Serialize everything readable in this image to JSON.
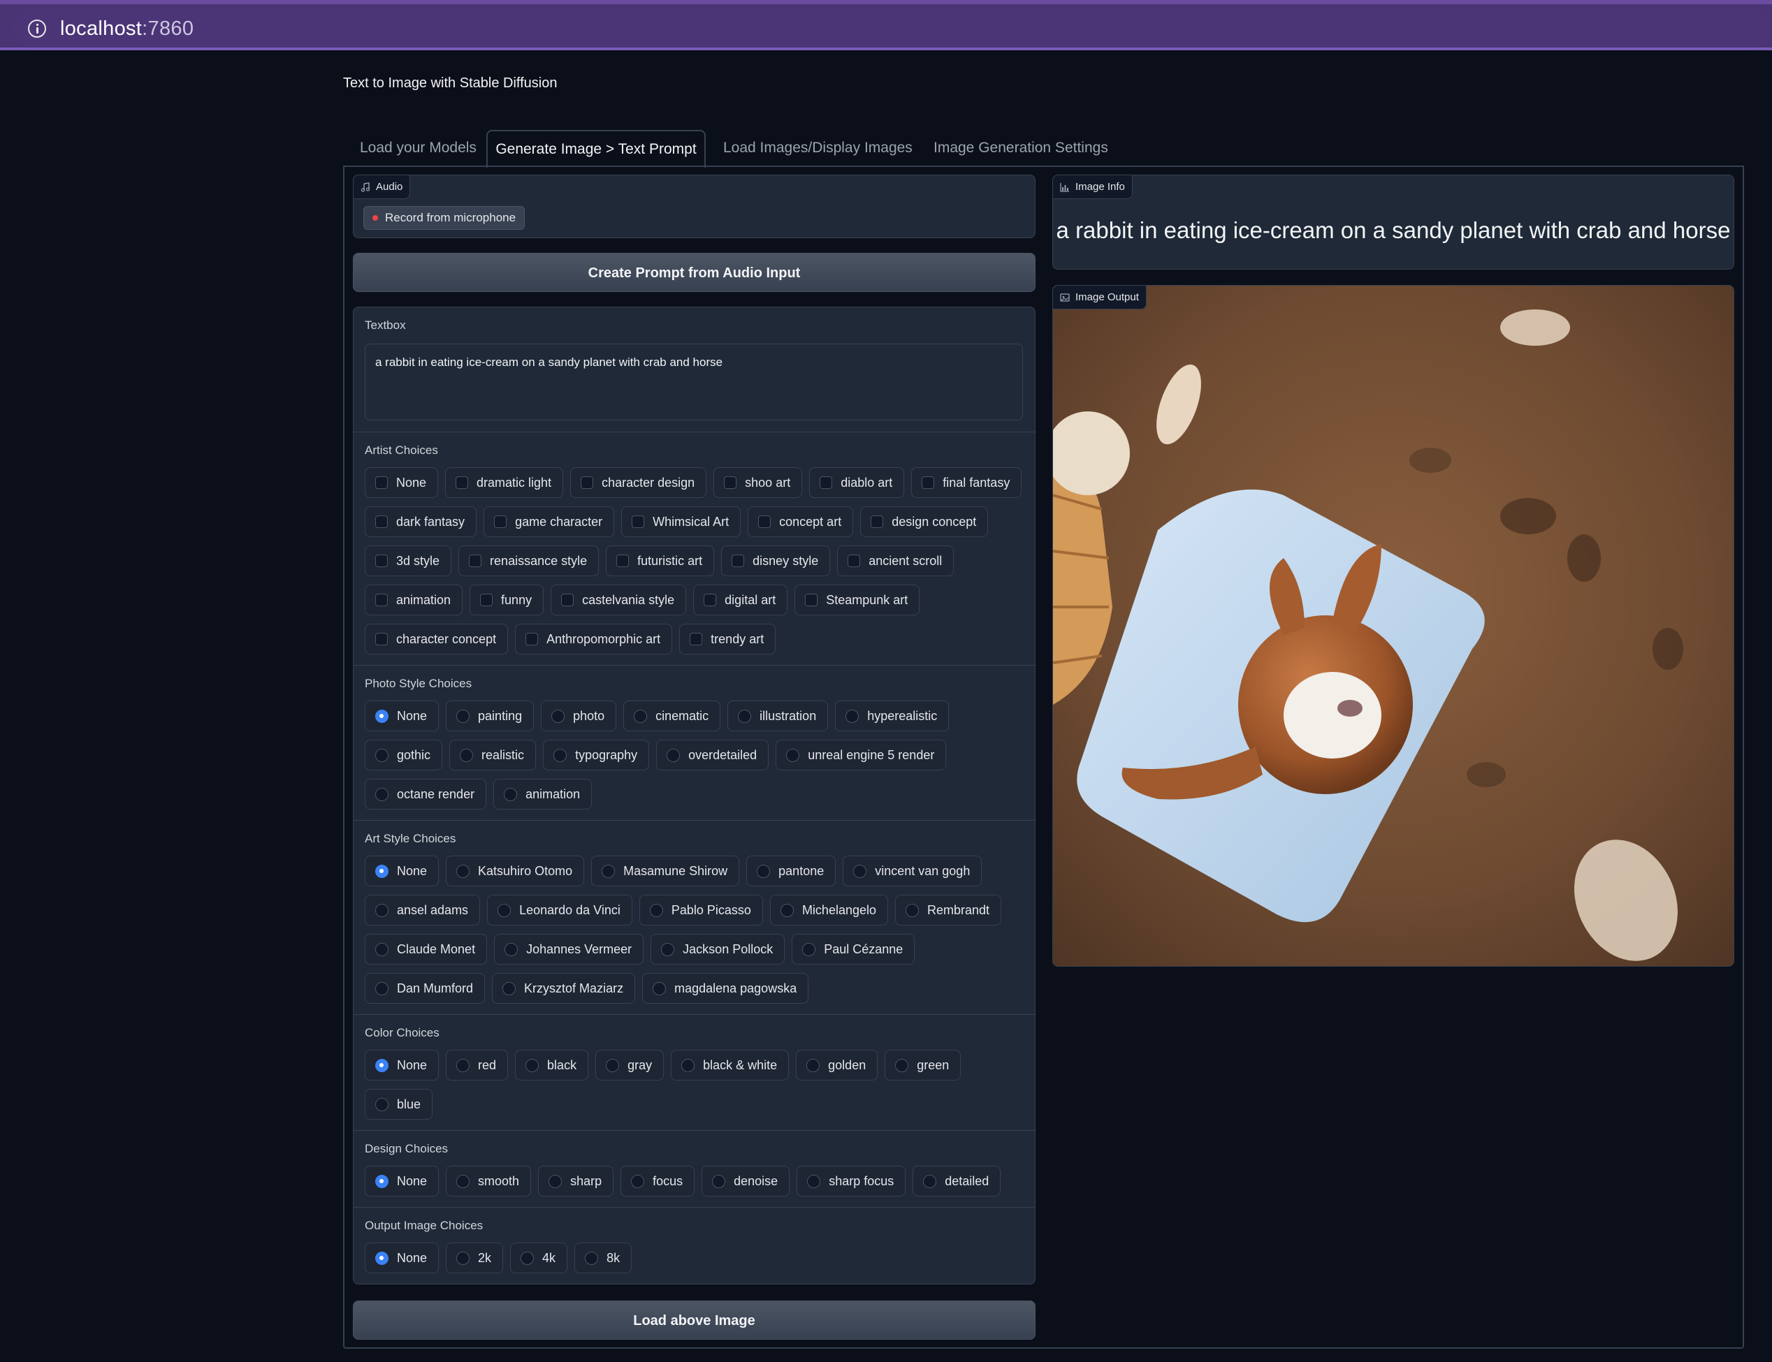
{
  "browser": {
    "url_host": "localhost",
    "url_port": ":7860"
  },
  "app": {
    "title": "Text to Image with Stable Diffusion"
  },
  "tabs": [
    {
      "label": "Load your Models"
    },
    {
      "label": "Generate Image > Text Prompt"
    },
    {
      "label": "Load Images/Display Images"
    },
    {
      "label": "Image Generation Settings"
    }
  ],
  "audio": {
    "label": "Audio",
    "record_label": "Record from microphone"
  },
  "create_prompt_button": "Create Prompt from Audio Input",
  "textbox": {
    "label": "Textbox",
    "value": "a rabbit in eating ice-cream on a sandy planet with crab and horse"
  },
  "artist": {
    "label": "Artist Choices",
    "options": [
      "None",
      "dramatic light",
      "character design",
      "shoo art",
      "diablo art",
      "final fantasy",
      "dark fantasy",
      "game character",
      "Whimsical Art",
      "concept art",
      "design concept",
      "3d style",
      "renaissance style",
      "futuristic art",
      "disney style",
      "ancient scroll",
      "animation",
      "funny",
      "castelvania style",
      "digital art",
      "Steampunk art",
      "character concept",
      "Anthropomorphic art",
      "trendy art"
    ]
  },
  "photo_style": {
    "label": "Photo Style Choices",
    "selected": "None",
    "options": [
      "None",
      "painting",
      "photo",
      "cinematic",
      "illustration",
      "hyperealistic",
      "gothic",
      "realistic",
      "typography",
      "overdetailed",
      "unreal engine 5 render",
      "octane render",
      "animation"
    ]
  },
  "art_style": {
    "label": "Art Style Choices",
    "selected": "None",
    "options": [
      "None",
      "Katsuhiro Otomo",
      "Masamune Shirow",
      "pantone",
      "vincent van gogh",
      "ansel adams",
      "Leonardo da Vinci",
      "Pablo Picasso",
      "Michelangelo",
      "Rembrandt",
      "Claude Monet",
      "Johannes Vermeer",
      "Jackson Pollock",
      "Paul Cézanne",
      "Dan Mumford",
      "Krzysztof Maziarz",
      "magdalena pagowska"
    ]
  },
  "color": {
    "label": "Color Choices",
    "selected": "None",
    "options": [
      "None",
      "red",
      "black",
      "gray",
      "black & white",
      "golden",
      "green",
      "blue"
    ]
  },
  "design": {
    "label": "Design Choices",
    "selected": "None",
    "options": [
      "None",
      "smooth",
      "sharp",
      "focus",
      "denoise",
      "sharp focus",
      "detailed"
    ]
  },
  "output_image": {
    "label": "Output Image Choices",
    "selected": "None",
    "options": [
      "None",
      "2k",
      "4k",
      "8k"
    ]
  },
  "load_image_button": "Load above Image",
  "image_info": {
    "label": "Image Info",
    "text": "a rabbit in eating ice-cream on a sandy planet with crab and horse"
  },
  "image_output": {
    "label": "Image Output"
  },
  "colors": {
    "accent": "#3b82f6",
    "browser_bar": "#4a3474",
    "background": "#0b0f19",
    "panel": "#1f2937",
    "border": "#374151"
  }
}
